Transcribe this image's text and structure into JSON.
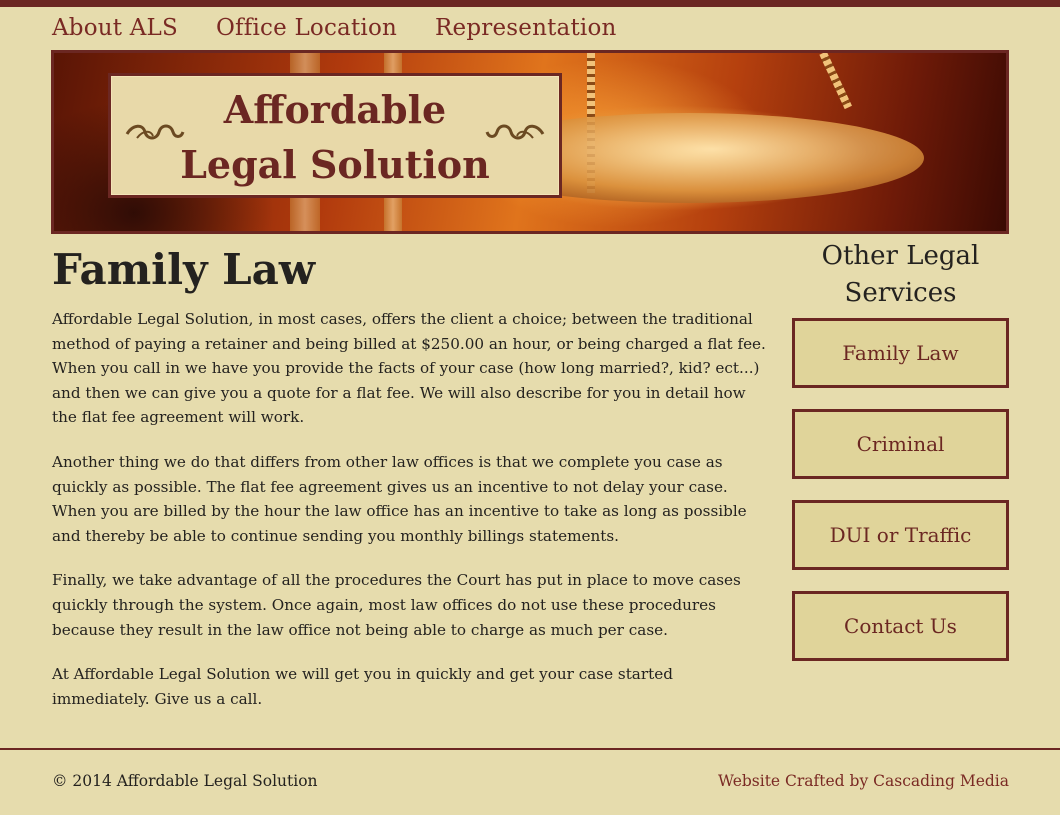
{
  "nav": {
    "items": [
      {
        "label": "About ALS"
      },
      {
        "label": "Office Location"
      },
      {
        "label": "Representation"
      }
    ]
  },
  "banner": {
    "title_line1": "Affordable",
    "title_line2": "Legal Solution"
  },
  "main": {
    "title": "Family Law",
    "paragraphs": [
      "Affordable Legal Solution, in most cases, offers the client a choice; between the traditional method of paying a retainer and being billed at $250.00 an hour, or being charged a flat fee. When you call in we have you provide the facts of your case (how long married?, kid? ect...) and then we can give you a quote for a flat fee. We will also describe for you in detail how the flat fee agreement will work.",
      "Another thing we do that differs from other law offices is that we complete you case as quickly as possible. The flat fee agreement gives us an incentive to not delay your case. When you are billed by the hour the law office has an incentive to take as long as possible and thereby be able to continue sending you monthly billings statements.",
      "Finally, we take advantage of all the procedures the Court has put in place to move cases quickly through the system. Once again, most law offices do not use these procedures because they result in the law office not being able to charge as much per case.",
      "At Affordable Legal Solution we will get you in quickly and get your case started immediately. Give us a call."
    ]
  },
  "sidebar": {
    "title": "Other Legal Services",
    "buttons": [
      {
        "label": "Family Law"
      },
      {
        "label": "Criminal"
      },
      {
        "label": "DUI or Traffic"
      },
      {
        "label": "Contact Us"
      }
    ]
  },
  "footer": {
    "copyright": "© 2014 Affordable Legal Solution",
    "credit": "Website Crafted by Cascading Media"
  },
  "colors": {
    "background": "#e6dcad",
    "accent": "#6b2722",
    "button_bg": "#e0d49a"
  },
  "icons": {
    "banner_left_ornament": "scroll-flourish-icon",
    "banner_right_ornament": "scroll-flourish-icon"
  }
}
